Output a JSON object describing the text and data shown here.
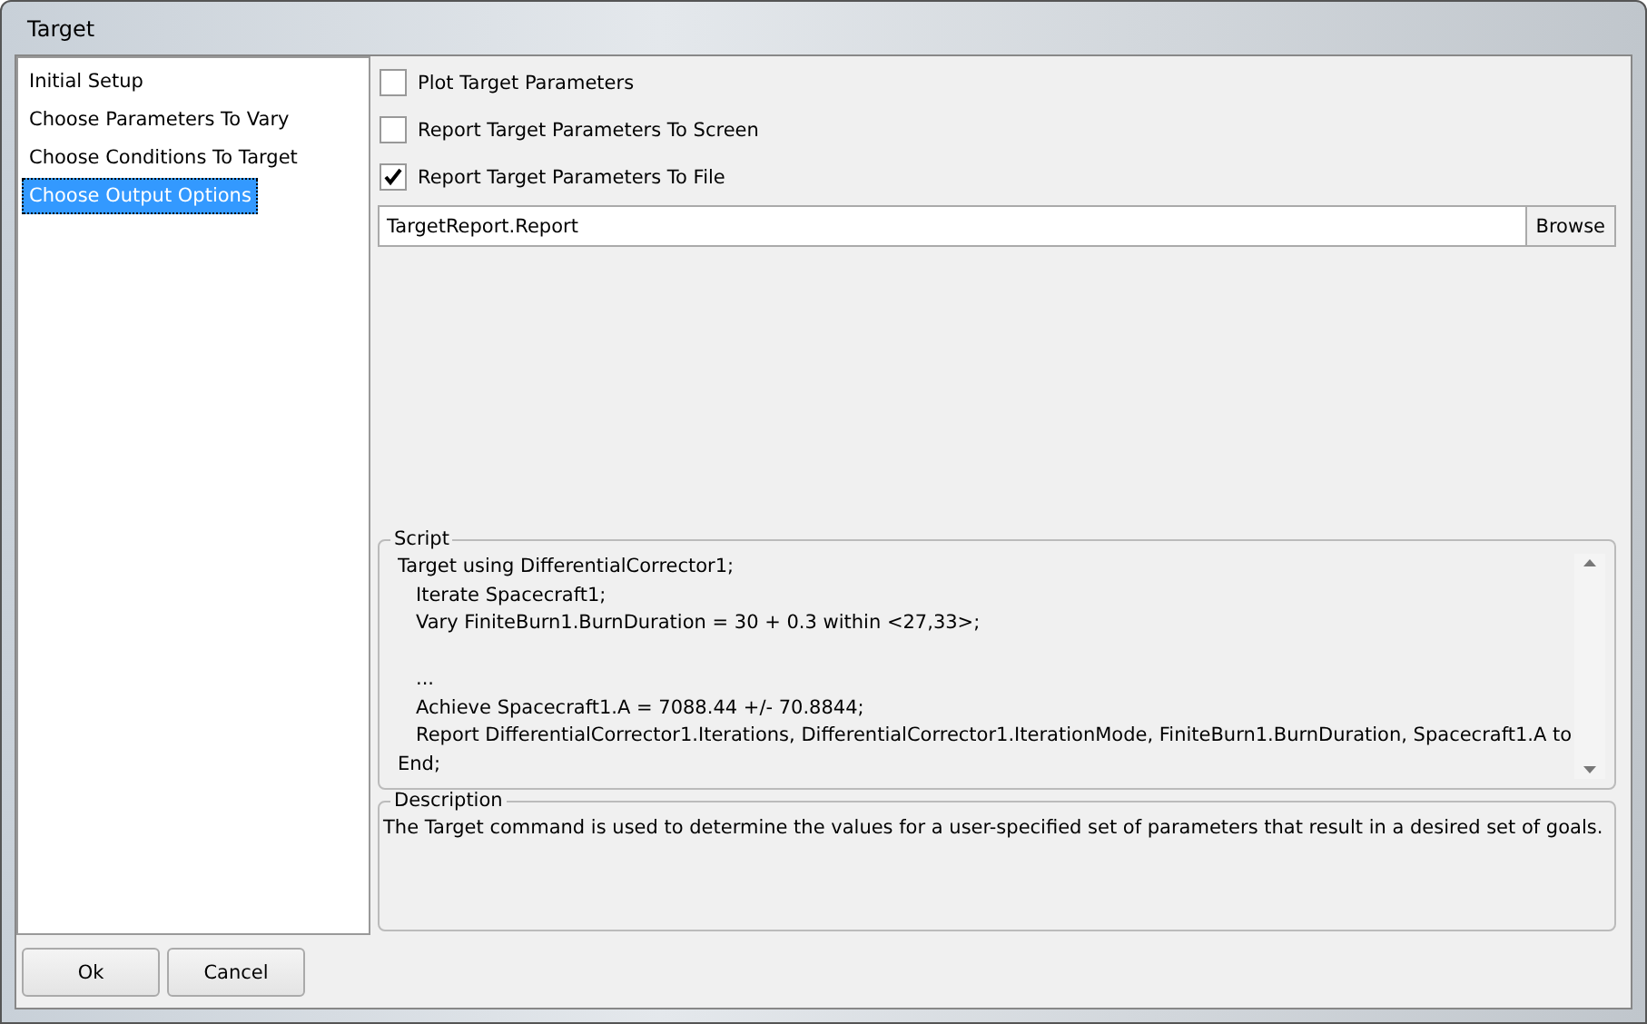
{
  "window": {
    "title": "Target"
  },
  "sidebar": {
    "items": [
      {
        "label": "Initial Setup",
        "selected": false
      },
      {
        "label": "Choose Parameters To Vary",
        "selected": false
      },
      {
        "label": "Choose Conditions To Target",
        "selected": false
      },
      {
        "label": "Choose Output Options",
        "selected": true
      }
    ]
  },
  "options": [
    {
      "label": "Plot Target Parameters",
      "checked": false
    },
    {
      "label": "Report Target Parameters To Screen",
      "checked": false
    },
    {
      "label": "Report Target Parameters To File",
      "checked": true
    }
  ],
  "file_field": {
    "value": "TargetReport.Report",
    "button": "Browse"
  },
  "script": {
    "title": "Script",
    "lines": [
      {
        "text": "Target using DifferentialCorrector1;",
        "indented": false,
        "gap_before": false
      },
      {
        "text": "Iterate Spacecraft1;",
        "indented": true,
        "gap_before": false
      },
      {
        "text": "Vary FiniteBurn1.BurnDuration = 30 + 0.3 within <27,33>;",
        "indented": true,
        "gap_before": false
      },
      {
        "text": "...",
        "indented": true,
        "gap_before": true
      },
      {
        "text": "Achieve Spacecraft1.A = 7088.44 +/- 70.8844;",
        "indented": true,
        "gap_before": false
      },
      {
        "text": "Report DifferentialCorrector1.Iterations, DifferentialCorrector1.IterationMode, FiniteBurn1.BurnDuration, Spacecraft1.A to",
        "indented": true,
        "gap_before": false
      },
      {
        "text": "End;",
        "indented": false,
        "gap_before": false
      }
    ]
  },
  "description": {
    "title": "Description",
    "text": "The Target command is used to determine the values for a user-specified set of parameters that result in a desired set of goals."
  },
  "buttons": [
    "Ok",
    "Cancel"
  ]
}
